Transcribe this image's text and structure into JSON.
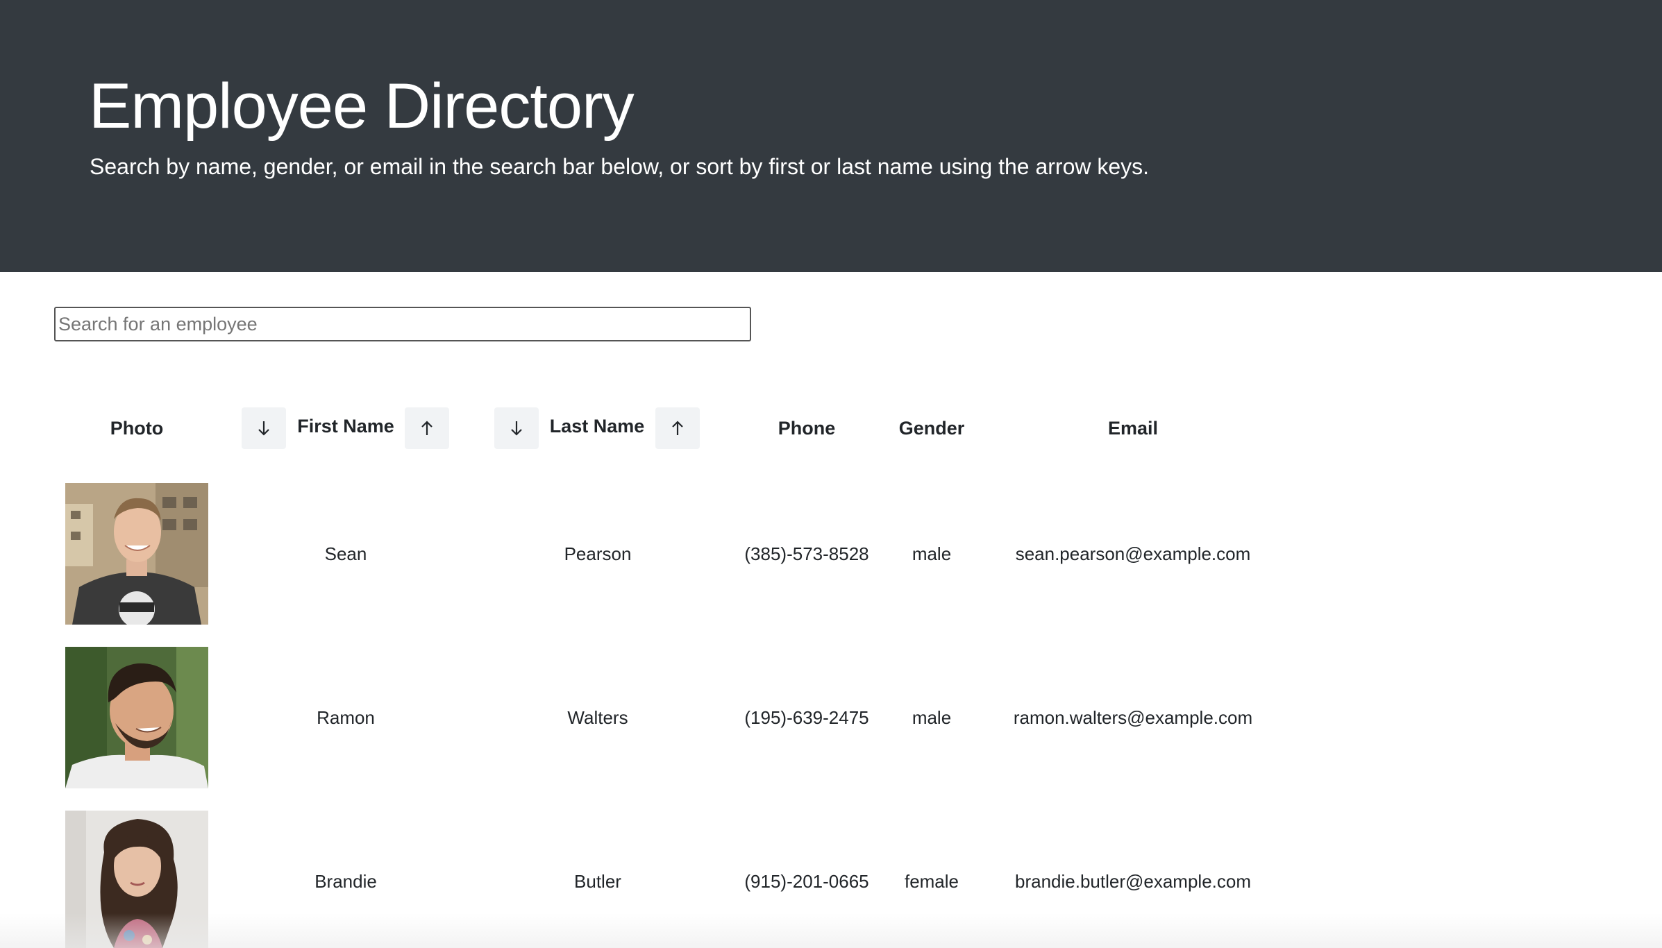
{
  "header": {
    "title": "Employee Directory",
    "subtitle": "Search by name, gender, or email in the search bar below, or sort by first or last name using the arrow keys."
  },
  "search": {
    "placeholder": "Search for an employee",
    "value": ""
  },
  "table": {
    "columns": {
      "photo": "Photo",
      "first_name": "First Name",
      "last_name": "Last Name",
      "phone": "Phone",
      "gender": "Gender",
      "email": "Email"
    },
    "sort_icons": [
      "arrow-down-icon",
      "arrow-up-icon"
    ],
    "rows": [
      {
        "first": "Sean",
        "last": "Pearson",
        "phone": "(385)-573-8528",
        "gender": "male",
        "email": "sean.pearson@example.com"
      },
      {
        "first": "Ramon",
        "last": "Walters",
        "phone": "(195)-639-2475",
        "gender": "male",
        "email": "ramon.walters@example.com"
      },
      {
        "first": "Brandie",
        "last": "Butler",
        "phone": "(915)-201-0665",
        "gender": "female",
        "email": "brandie.butler@example.com"
      }
    ]
  },
  "colors": {
    "header_bg": "#343a40",
    "sort_button_bg": "#f1f3f5",
    "text": "#212529"
  }
}
